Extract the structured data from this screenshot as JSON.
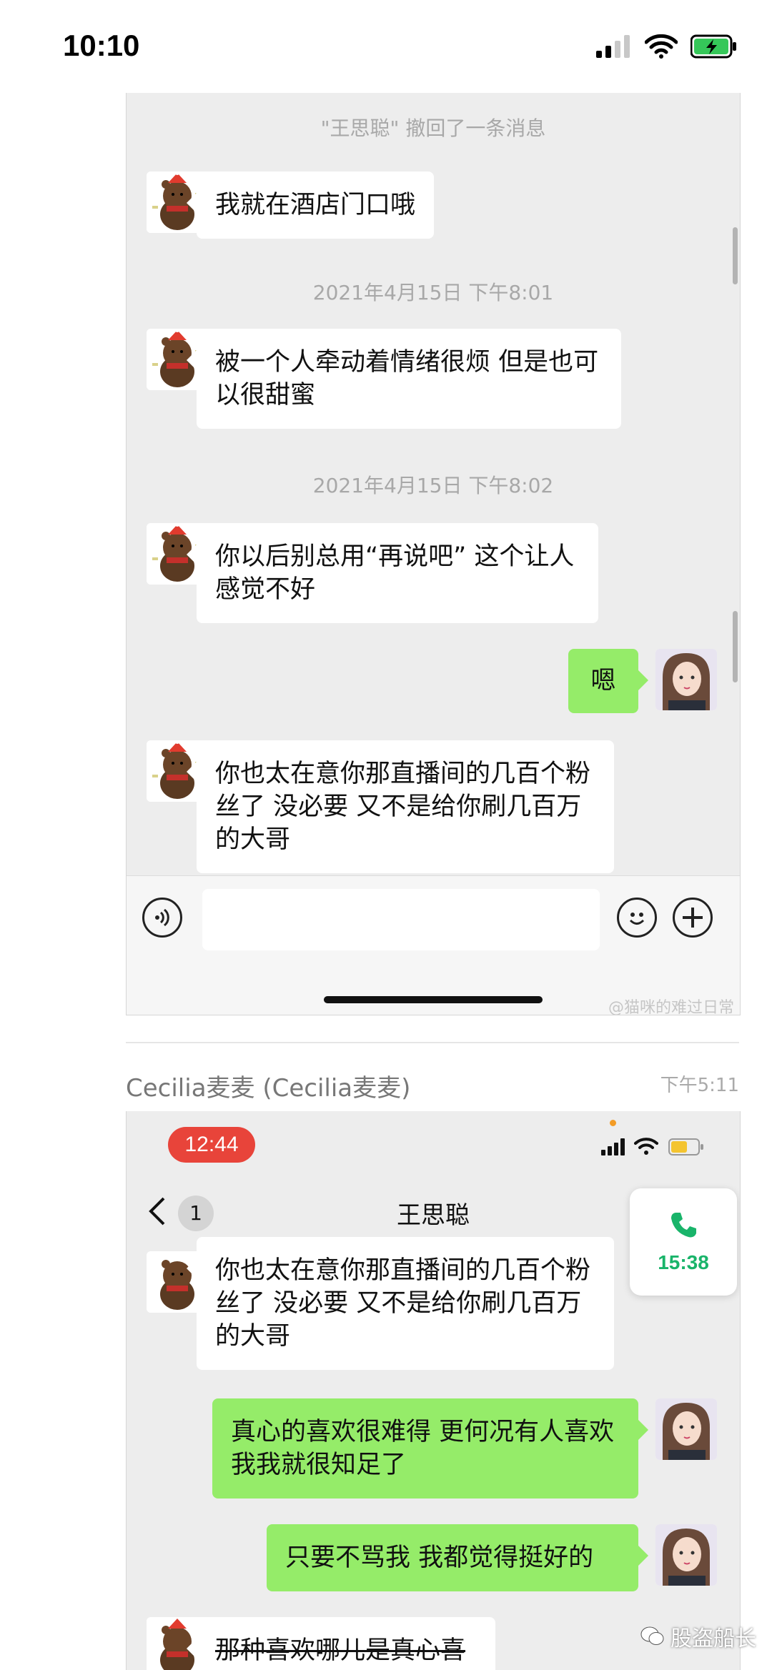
{
  "status_bar": {
    "time": "10:10"
  },
  "shot1": {
    "recall_notice": "\"王思聪\" 撤回了一条消息",
    "messages": [
      {
        "text": "我就在酒店门口哦"
      },
      {
        "timestamp": "2021年4月15日 下午8:01",
        "text": "被一个人牵动着情绪很烦 但是也可以很甜蜜"
      },
      {
        "timestamp": "2021年4月15日 下午8:02",
        "text": "你以后别总用“再说吧” 这个让人感觉不好"
      },
      {
        "text": "嗯"
      },
      {
        "text": "你也太在意你那直播间的几百个粉丝了 没必要 又不是给你刷几百万的大哥"
      }
    ],
    "watermark": "@猫咪的难过日常"
  },
  "forward": {
    "sender": "Cecilia麦麦 (Cecilia麦麦)",
    "time": "下午5:11"
  },
  "shot2": {
    "status_time": "12:44",
    "nav_title": "王思聪",
    "unread_badge": "1",
    "call_timer": "15:38",
    "messages": [
      {
        "text": "你也太在意你那直播间的几百个粉丝了 没必要 又不是给你刷几百万的大哥"
      },
      {
        "text": "真心的喜欢很难得 更何况有人喜欢我我就很知足了"
      },
      {
        "text": "只要不骂我 我都觉得挺好的"
      },
      {
        "text": "那种喜欢哪儿是真心喜欢"
      }
    ]
  },
  "footer_watermark": "股盗船长",
  "colors": {
    "green_bubble": "#95ec69",
    "call_green": "#19b46a",
    "red_pill": "#e8443a"
  }
}
